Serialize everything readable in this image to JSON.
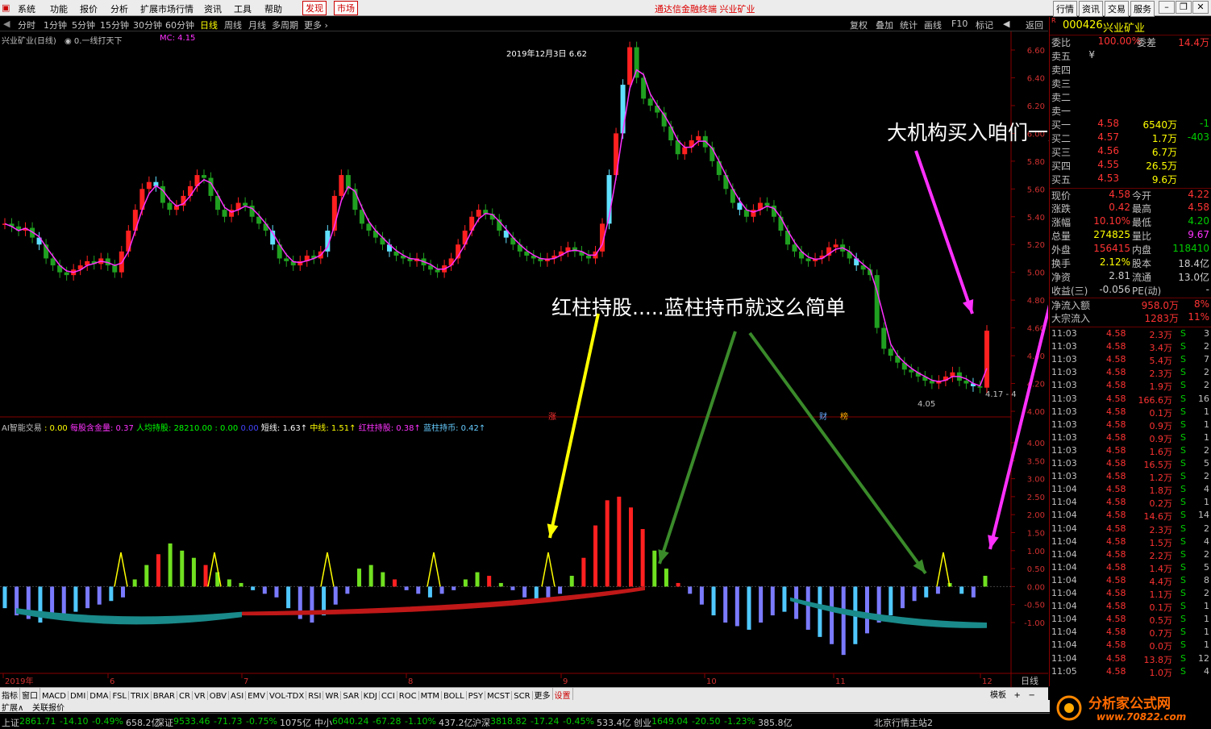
{
  "menu": {
    "items": [
      "系统",
      "功能",
      "报价",
      "分析",
      "扩展市场行情",
      "资讯",
      "工具",
      "帮助"
    ],
    "discover": "发现",
    "market": "市场",
    "title": "通达信金融终端 兴业矿业",
    "right": [
      "行情",
      "资讯",
      "交易",
      "服务"
    ]
  },
  "periods": [
    "分时",
    "1分钟",
    "5分钟",
    "15分钟",
    "30分钟",
    "60分钟",
    "日线",
    "周线",
    "月线",
    "多周期",
    "更多 ›"
  ],
  "period_active": "日线",
  "chart_tools": [
    "复权",
    "叠加",
    "统计",
    "画线",
    "F10",
    "标记",
    "◀",
    "返回"
  ],
  "main_header": {
    "name": "兴业矿业(日线)",
    "formula": "0.一线打天下",
    "mc": "MC: 4.15"
  },
  "price_axis": [
    "6.60",
    "6.40",
    "6.20",
    "6.00",
    "5.80",
    "5.60",
    "5.40",
    "5.20",
    "5.00",
    "4.80",
    "4.60",
    "4.40",
    "4.20",
    "4.00"
  ],
  "peak_label": "2019年12月3日 6.62",
  "low_label": "4.05",
  "last_label": "4.17 - 4",
  "markers": {
    "zhang": "涨",
    "cai": "财",
    "bang": "榜"
  },
  "ind_header": {
    "name": "AI智能交易",
    "v0": ": 0.00",
    "gold_label": "每股含金量",
    "gold": ": 0.37",
    "hold_label": "人均持股",
    "hold": ": 28210.00 : 0.00",
    "dot": "0.00",
    "short_label": "短线",
    "short": ": 1.63↑",
    "mid_label": "中线",
    "mid": ": 1.51↑",
    "red_label": "红柱持股",
    "red": ": 0.38↑",
    "blue_label": "蓝柱持币",
    "blue": ": 0.42↑"
  },
  "ind_axis": [
    "4.00",
    "3.50",
    "3.00",
    "2.50",
    "2.00",
    "1.50",
    "1.00",
    "0.50",
    "0.00",
    "-0.50",
    "-1.00"
  ],
  "date_axis": [
    "2019年",
    "6",
    "7",
    "8",
    "9",
    "10",
    "11",
    "12"
  ],
  "date_right": "日线",
  "annotations": {
    "a1": "大机构买入咱们一起跟进",
    "a2": "红柱持股.....蓝柱持币就这么简单"
  },
  "quote": {
    "code": "000426",
    "name": "兴业矿业",
    "r_badge": "R",
    "ratio_label": "委比",
    "ratio": "100.00%",
    "diff_label": "委差",
    "diff": "14.4万",
    "sells": [
      {
        "l": "卖五",
        "p": "¥",
        "v": ""
      },
      {
        "l": "卖四",
        "p": "",
        "v": ""
      },
      {
        "l": "卖三",
        "p": "",
        "v": ""
      },
      {
        "l": "卖二",
        "p": "",
        "v": ""
      },
      {
        "l": "卖一",
        "p": "",
        "v": ""
      }
    ],
    "buys": [
      {
        "l": "买一",
        "p": "4.58",
        "v": "6540万",
        "c": "-1"
      },
      {
        "l": "买二",
        "p": "4.57",
        "v": "1.7万",
        "c": "-403"
      },
      {
        "l": "买三",
        "p": "4.56",
        "v": "6.7万",
        "c": ""
      },
      {
        "l": "买四",
        "p": "4.55",
        "v": "26.5万",
        "c": ""
      },
      {
        "l": "买五",
        "p": "4.53",
        "v": "9.6万",
        "c": ""
      }
    ],
    "stats": [
      {
        "l1": "现价",
        "v1": "4.58",
        "l2": "今开",
        "v2": "4.22"
      },
      {
        "l1": "涨跌",
        "v1": "0.42",
        "l2": "最高",
        "v2": "4.58"
      },
      {
        "l1": "涨幅",
        "v1": "10.10%",
        "l2": "最低",
        "v2": "4.20"
      },
      {
        "l1": "总量",
        "v1": "274825",
        "l2": "量比",
        "v2": "9.67"
      },
      {
        "l1": "外盘",
        "v1": "156415",
        "l2": "内盘",
        "v2": "118410"
      },
      {
        "l1": "换手",
        "v1": "2.12%",
        "l2": "股本",
        "v2": "18.4亿"
      },
      {
        "l1": "净资",
        "v1": "2.81",
        "l2": "流通",
        "v2": "13.0亿"
      },
      {
        "l1": "收益(三)",
        "v1": "-0.056",
        "l2": "PE(动)",
        "v2": "-"
      }
    ],
    "flows": [
      {
        "l": "净流入额",
        "v": "958.0万",
        "p": "8%"
      },
      {
        "l": "大宗流入",
        "v": "1283万",
        "p": "11%"
      }
    ]
  },
  "ticks": [
    [
      "11:03",
      "4.58",
      "2.3万",
      "S",
      "3"
    ],
    [
      "11:03",
      "4.58",
      "3.4万",
      "S",
      "2"
    ],
    [
      "11:03",
      "4.58",
      "5.4万",
      "S",
      "7"
    ],
    [
      "11:03",
      "4.58",
      "2.3万",
      "S",
      "2"
    ],
    [
      "11:03",
      "4.58",
      "1.9万",
      "S",
      "2"
    ],
    [
      "11:03",
      "4.58",
      "166.6万",
      "S",
      "16"
    ],
    [
      "11:03",
      "4.58",
      "0.1万",
      "S",
      "1"
    ],
    [
      "11:03",
      "4.58",
      "0.9万",
      "S",
      "1"
    ],
    [
      "11:03",
      "4.58",
      "0.9万",
      "S",
      "1"
    ],
    [
      "11:03",
      "4.58",
      "1.6万",
      "S",
      "2"
    ],
    [
      "11:03",
      "4.58",
      "16.5万",
      "S",
      "5"
    ],
    [
      "11:03",
      "4.58",
      "1.2万",
      "S",
      "2"
    ],
    [
      "11:04",
      "4.58",
      "1.8万",
      "S",
      "4"
    ],
    [
      "11:04",
      "4.58",
      "0.2万",
      "S",
      "1"
    ],
    [
      "11:04",
      "4.58",
      "14.6万",
      "S",
      "14"
    ],
    [
      "11:04",
      "4.58",
      "2.3万",
      "S",
      "2"
    ],
    [
      "11:04",
      "4.58",
      "1.5万",
      "S",
      "4"
    ],
    [
      "11:04",
      "4.58",
      "2.2万",
      "S",
      "2"
    ],
    [
      "11:04",
      "4.58",
      "1.4万",
      "S",
      "5"
    ],
    [
      "11:04",
      "4.58",
      "4.4万",
      "S",
      "8"
    ],
    [
      "11:04",
      "4.58",
      "1.1万",
      "S",
      "2"
    ],
    [
      "11:04",
      "4.58",
      "0.1万",
      "S",
      "1"
    ],
    [
      "11:04",
      "4.58",
      "0.5万",
      "S",
      "1"
    ],
    [
      "11:04",
      "4.58",
      "0.7万",
      "S",
      "1"
    ],
    [
      "11:04",
      "4.58",
      "0.0万",
      "S",
      "1"
    ],
    [
      "11:04",
      "4.58",
      "13.8万",
      "S",
      "12"
    ],
    [
      "11:05",
      "4.58",
      "1.0万",
      "S",
      "4"
    ]
  ],
  "indicators": [
    "指标",
    "窗口",
    "MACD",
    "DMI",
    "DMA",
    "FSL",
    "TRIX",
    "BRAR",
    "CR",
    "VR",
    "OBV",
    "ASI",
    "EMV",
    "VOL-TDX",
    "RSI",
    "WR",
    "SAR",
    "KDJ",
    "CCI",
    "ROC",
    "MTM",
    "BOLL",
    "PSY",
    "MCST",
    "SCR",
    "更多",
    "设置"
  ],
  "indicator_active": "设置",
  "ind_right": [
    "模板",
    "+",
    "−"
  ],
  "expand": [
    "扩展∧",
    "关联报价"
  ],
  "status": [
    {
      "n": "上证",
      "v": "2861.71",
      "c": "-14.10",
      "p": "-0.49%",
      "a": "658.2亿"
    },
    {
      "n": "深证",
      "v": "9533.46",
      "c": "-71.73",
      "p": "-0.75%",
      "a": "1075亿"
    },
    {
      "n": "中小",
      "v": "6040.24",
      "c": "-67.28",
      "p": "-1.10%",
      "a": "437.2亿"
    },
    {
      "n": "沪深",
      "v": "3818.82",
      "c": "-17.24",
      "p": "-0.45%",
      "a": "533.4亿"
    },
    {
      "n": "创业",
      "v": "1649.04",
      "c": "-20.50",
      "p": "-1.23%",
      "a": "385.8亿"
    }
  ],
  "server": "北京行情主站2",
  "logo": {
    "name": "分析家公式网",
    "url": "www.70822.com"
  },
  "colors": {
    "up": "#ff2020",
    "down": "#20a020",
    "cyan": "#60e0ff",
    "magenta": "#ff30ff",
    "yellow": "#ffff00",
    "blue_hist": "#7a7aff",
    "lightblue": "#50c8ff",
    "green_hist": "#70e020"
  }
}
